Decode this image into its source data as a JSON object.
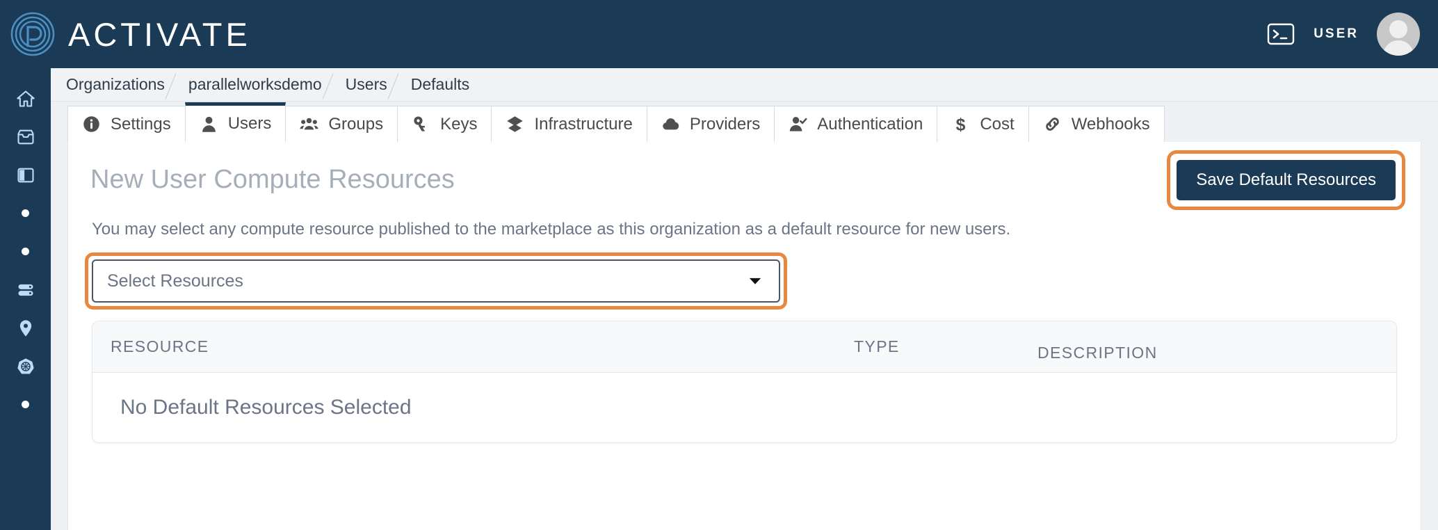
{
  "brand": {
    "name": "ACTIVATE"
  },
  "topbar": {
    "terminal_icon": "terminal-icon",
    "user_label": "USER",
    "avatar": "user-avatar"
  },
  "sidebar": {
    "items": [
      {
        "icon": "home-icon",
        "type": "icon"
      },
      {
        "icon": "inbox-icon",
        "type": "icon"
      },
      {
        "icon": "panel-columns-icon",
        "type": "icon"
      },
      {
        "icon": "dot-icon",
        "type": "dot"
      },
      {
        "icon": "dot-icon",
        "type": "dot"
      },
      {
        "icon": "server-icon",
        "type": "icon"
      },
      {
        "icon": "map-pin-icon",
        "type": "icon"
      },
      {
        "icon": "kubernetes-icon",
        "type": "icon"
      },
      {
        "icon": "dot-icon",
        "type": "dot"
      }
    ]
  },
  "breadcrumb": {
    "items": [
      "Organizations",
      "parallelworksdemo",
      "Users",
      "Defaults"
    ]
  },
  "tabs": [
    {
      "label": "Settings",
      "icon": "info-circle-icon",
      "active": false
    },
    {
      "label": "Users",
      "icon": "user-icon",
      "active": true
    },
    {
      "label": "Groups",
      "icon": "users-group-icon",
      "active": false
    },
    {
      "label": "Keys",
      "icon": "key-icon",
      "active": false
    },
    {
      "label": "Infrastructure",
      "icon": "layers-icon",
      "active": false
    },
    {
      "label": "Providers",
      "icon": "cloud-icon",
      "active": false
    },
    {
      "label": "Authentication",
      "icon": "user-check-icon",
      "active": false
    },
    {
      "label": "Cost",
      "icon": "dollar-icon",
      "active": false
    },
    {
      "label": "Webhooks",
      "icon": "link-chain-icon",
      "active": false
    }
  ],
  "main": {
    "title": "New User Compute Resources",
    "save_button": "Save Default Resources",
    "description": "You may select any compute resource published to the marketplace as this organization as a default resource for new users.",
    "select": {
      "value": "Select Resources",
      "chevron": "chevron-down-icon"
    },
    "table": {
      "columns": [
        "RESOURCE",
        "TYPE",
        "DESCRIPTION"
      ],
      "empty_message": "No Default Resources Selected",
      "rows": []
    }
  },
  "colors": {
    "header_navy": "#1b3a56",
    "highlight_orange": "#e8883f",
    "page_bg": "#eef1f4",
    "muted_text": "#6b7585"
  }
}
